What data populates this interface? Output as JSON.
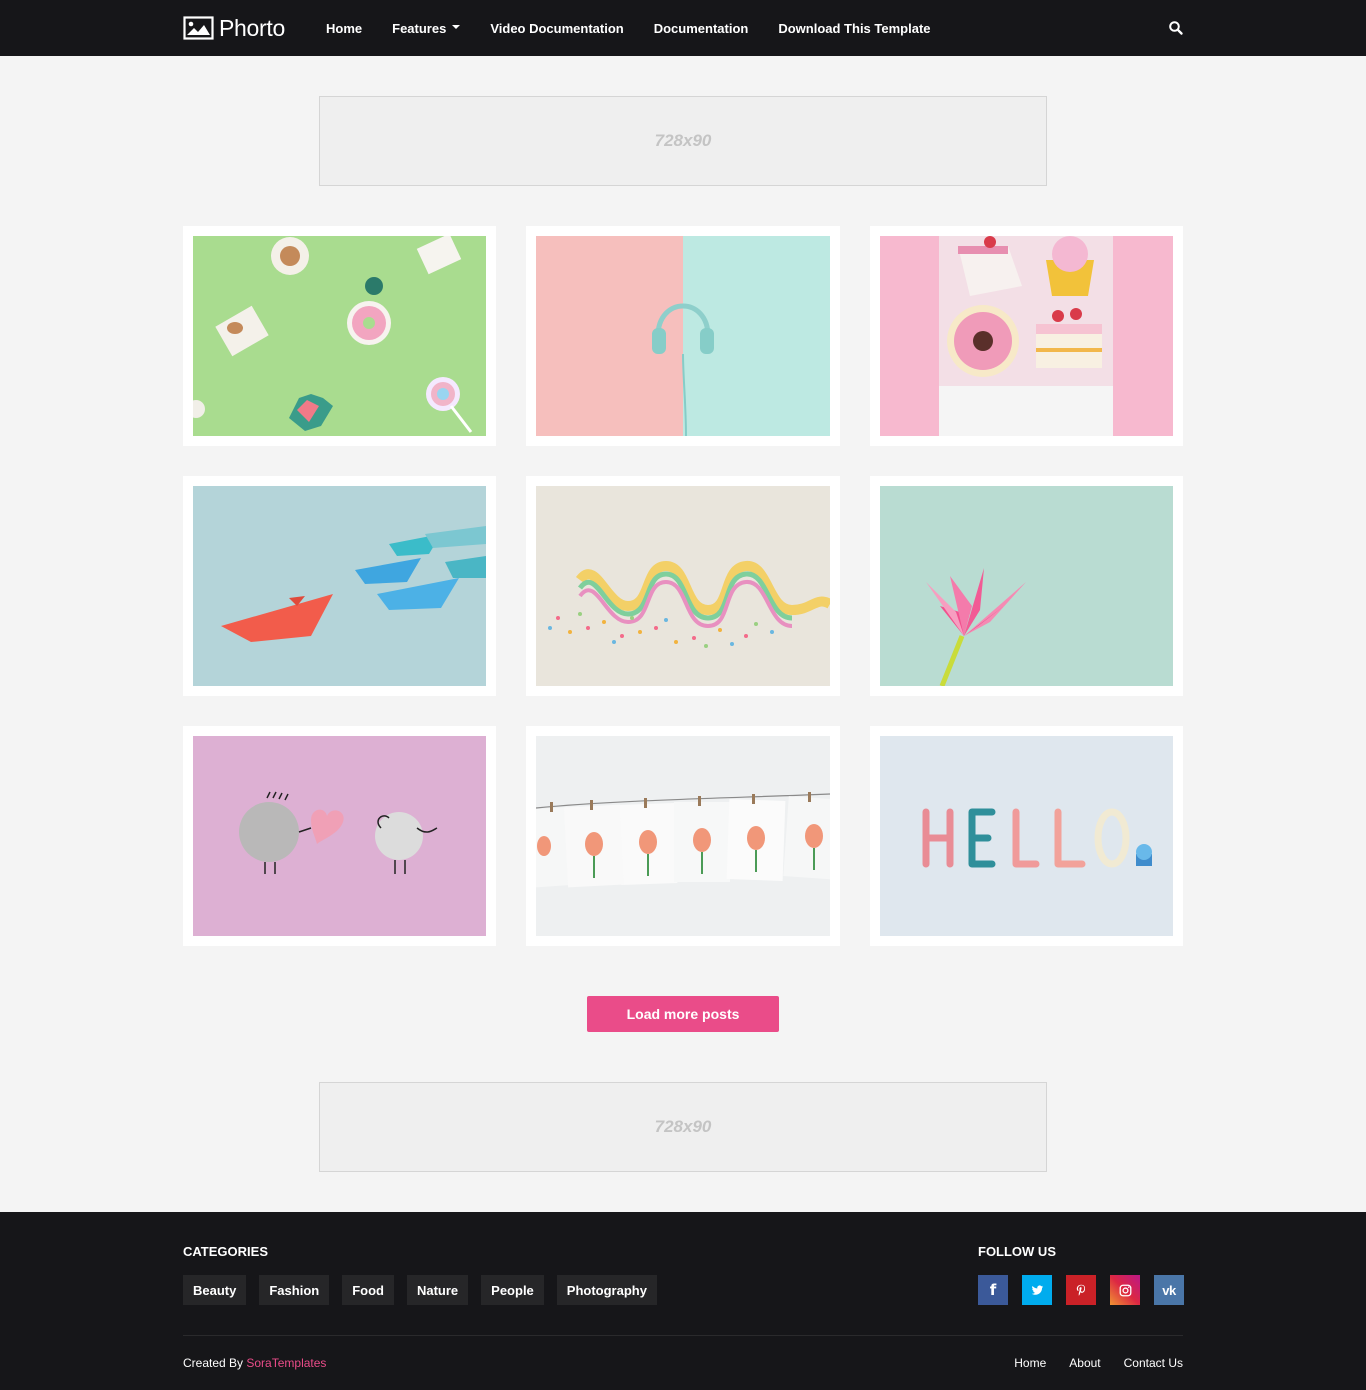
{
  "header": {
    "brand": "Phorto",
    "nav": [
      {
        "label": "Home"
      },
      {
        "label": "Features",
        "has_dropdown": true
      },
      {
        "label": "Video Documentation"
      },
      {
        "label": "Documentation"
      },
      {
        "label": "Download This Template"
      }
    ],
    "search_icon": "search-icon"
  },
  "ads": {
    "top": "728x90",
    "bottom": "728x90"
  },
  "posts": [
    {
      "thumb": "green-candies"
    },
    {
      "thumb": "headphones-pink-teal"
    },
    {
      "thumb": "pink-desserts"
    },
    {
      "thumb": "paper-boats"
    },
    {
      "thumb": "rainbow-ribbon"
    },
    {
      "thumb": "paper-lily"
    },
    {
      "thumb": "pebble-couple"
    },
    {
      "thumb": "flower-cards-clothesline"
    },
    {
      "thumb": "hello-clay-letters"
    }
  ],
  "load_more": {
    "label": "Load more posts"
  },
  "footer": {
    "categories_title": "CATEGORIES",
    "categories": [
      "Beauty",
      "Fashion",
      "Food",
      "Nature",
      "People",
      "Photography"
    ],
    "follow_title": "FOLLOW US",
    "socials": [
      {
        "name": "facebook-icon",
        "glyph": "f",
        "color": "#3b5999"
      },
      {
        "name": "twitter-icon",
        "glyph": "",
        "color": "#00acee"
      },
      {
        "name": "pinterest-icon",
        "glyph": "",
        "color": "#ca2127"
      },
      {
        "name": "instagram-icon",
        "glyph": "",
        "color": "#c13584"
      },
      {
        "name": "vk-icon",
        "glyph": "vk",
        "color": "#4a76a8"
      }
    ],
    "credit_prefix": "Created By",
    "credit_link": "SoraTemplates",
    "menu": [
      "Home",
      "About",
      "Contact Us"
    ]
  },
  "colors": {
    "accent": "#ea4c89",
    "header_bg": "#161619",
    "page_bg": "#f4f4f4"
  }
}
